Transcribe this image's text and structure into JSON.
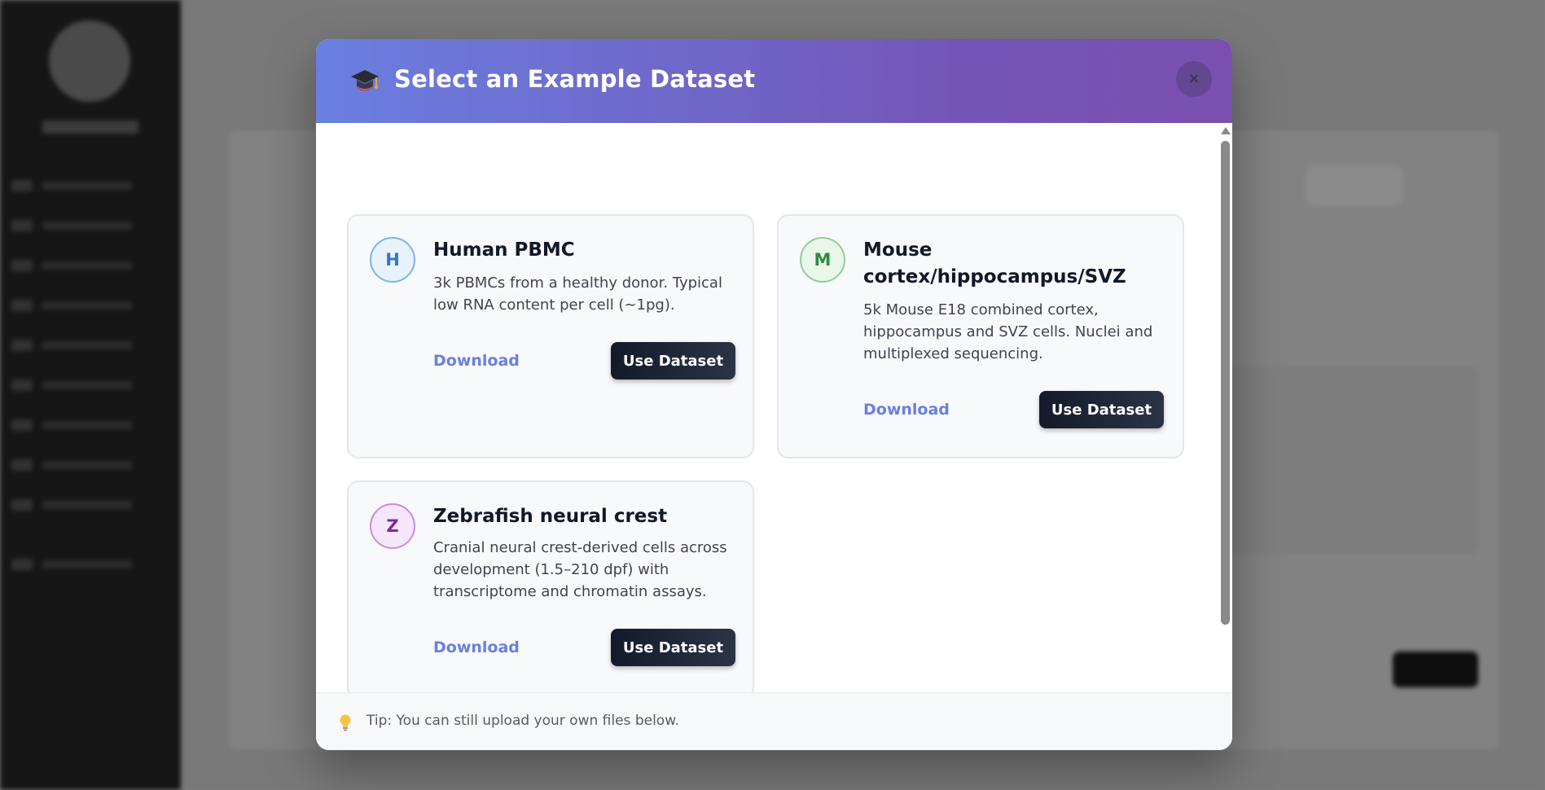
{
  "modal": {
    "title": "Select an Example Dataset",
    "header_icon": "graduation-cap-icon",
    "close_label": "×",
    "tip": "Tip: You can still upload your own files below.",
    "tip_icon": "lightbulb-icon",
    "gradient": [
      "#6a7fe0",
      "#7b4fb0"
    ]
  },
  "datasets": [
    {
      "initial": "H",
      "title": "Human PBMC",
      "description": "3k PBMCs from a healthy donor. Typical low RNA content per cell (~1pg).",
      "download_label": "Download",
      "use_label": "Use Dataset",
      "badge_color": "#2f79c8"
    },
    {
      "initial": "M",
      "title": "Mouse cortex/hippocampus/SVZ",
      "description": "5k Mouse E18 combined cortex, hippocampus and SVZ cells. Nuclei and multiplexed sequencing.",
      "download_label": "Download",
      "use_label": "Use Dataset",
      "badge_color": "#2e8b3e"
    },
    {
      "initial": "Z",
      "title": "Zebrafish neural crest",
      "description": "Cranial neural crest-derived cells across development (1.5–210 dpf) with transcriptome and chromatin assays.",
      "download_label": "Download",
      "use_label": "Use Dataset",
      "badge_color": "#7a2a9a"
    }
  ]
}
